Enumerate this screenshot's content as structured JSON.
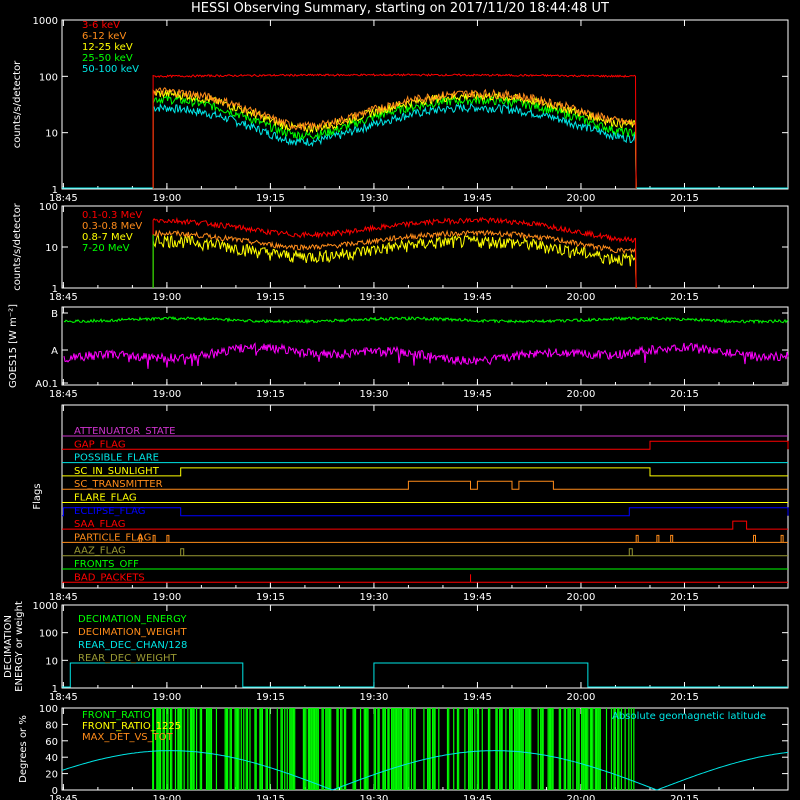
{
  "title": "HESSI Observing Summary, starting on 2017/11/20 18:44:48 UT",
  "time_ticks": [
    "18:45",
    "19:00",
    "19:15",
    "19:30",
    "19:45",
    "20:00",
    "20:15"
  ],
  "colors": {
    "red": "#ff0000",
    "orange": "#ff8c1a",
    "yellow": "#ffff00",
    "green": "#00ff00",
    "cyan": "#00e6e6",
    "magenta": "#ff00ff",
    "blue": "#0000ff",
    "white": "#ffffff",
    "olive": "#999933",
    "purple": "#cc33cc"
  },
  "chart_data": [
    {
      "id": "lo_energy",
      "type": "line",
      "ylabel": "counts/s/detector",
      "yscale": "log",
      "ylim": [
        1,
        1000
      ],
      "yticks": [
        "1",
        "10",
        "100",
        "1000"
      ],
      "x_start": "18:58",
      "x_end": "20:08",
      "series": [
        {
          "name": "3-6 keV",
          "color": "red",
          "values_at": {
            "start": 100,
            "mid": 110,
            "end": 90
          }
        },
        {
          "name": "6-12 keV",
          "color": "orange",
          "values_at": {
            "start": 55,
            "min": 13,
            "peak": 50,
            "end": 15
          }
        },
        {
          "name": "12-25 keV",
          "color": "yellow",
          "values_at": {
            "start": 50,
            "min": 12,
            "peak": 45,
            "end": 14
          }
        },
        {
          "name": "25-50 keV",
          "color": "green",
          "values_at": {
            "start": 40,
            "min": 9,
            "peak": 38,
            "end": 10
          }
        },
        {
          "name": "50-100 keV",
          "color": "cyan",
          "values_at": {
            "start": 28,
            "min": 7,
            "peak": 28,
            "end": 8
          }
        }
      ]
    },
    {
      "id": "hi_energy",
      "type": "line",
      "ylabel": "counts/s/detector",
      "yscale": "log",
      "ylim": [
        1,
        100
      ],
      "yticks": [
        "1",
        "10",
        "100"
      ],
      "series": [
        {
          "name": "0.1-0.3 MeV",
          "color": "red",
          "values_at": {
            "start": 45,
            "min": 20,
            "peak": 45,
            "end": 15
          }
        },
        {
          "name": "0.3-0.8 MeV",
          "color": "orange",
          "values_at": {
            "start": 22,
            "min": 10,
            "peak": 22,
            "end": 8
          }
        },
        {
          "name": "0.8-7 MeV",
          "color": "yellow",
          "values_at": {
            "start": 15,
            "min": 6,
            "peak": 14,
            "end": 5
          }
        },
        {
          "name": "7-20 MeV",
          "color": "green",
          "values_at": {}
        }
      ]
    },
    {
      "id": "goes",
      "type": "line",
      "ylabel": "GOES15 [W m⁻²]",
      "yticks": [
        "A0.1",
        "A",
        "B"
      ],
      "series": [
        {
          "color": "green",
          "level": "B-"
        },
        {
          "color": "magenta",
          "level": "A"
        }
      ]
    },
    {
      "id": "flags",
      "type": "line",
      "ylabel": "Flags",
      "flags": [
        {
          "name": "ATTENUATOR_STATE",
          "color": "purple"
        },
        {
          "name": "GAP_FLAG",
          "color": "red",
          "on": [
            [
              "20:10",
              "20:30"
            ]
          ]
        },
        {
          "name": "POSSIBLE_FLARE",
          "color": "cyan"
        },
        {
          "name": "SC_IN_SUNLIGHT",
          "color": "yellow",
          "on": [
            [
              "19:02",
              "20:10"
            ]
          ]
        },
        {
          "name": "SC_TRANSMITTER",
          "color": "orange",
          "on": [
            [
              "19:35",
              "19:44"
            ],
            [
              "19:45",
              "19:50"
            ],
            [
              "19:51",
              "19:56"
            ]
          ]
        },
        {
          "name": "FLARE_FLAG",
          "color": "yellow"
        },
        {
          "name": "ECLIPSE_FLAG",
          "color": "blue",
          "on": [
            [
              "18:45",
              "19:02"
            ],
            [
              "20:07",
              "20:30"
            ]
          ]
        },
        {
          "name": "SAA_FLAG",
          "color": "red",
          "on": [
            [
              "20:22",
              "20:24"
            ]
          ]
        },
        {
          "name": "PARTICLE_FLAG",
          "color": "orange"
        },
        {
          "name": "AAZ_FLAG",
          "color": "olive"
        },
        {
          "name": "FRONTS_OFF",
          "color": "green"
        },
        {
          "name": "BAD_PACKETS",
          "color": "red"
        }
      ]
    },
    {
      "id": "decimation",
      "type": "line",
      "ylabel": "DECIMATION ENERGY or weight",
      "yscale": "log",
      "ylim": [
        1,
        1000
      ],
      "yticks": [
        "1",
        "10",
        "100",
        "1000"
      ],
      "series": [
        {
          "name": "DECIMATION_ENERGY",
          "color": "green"
        },
        {
          "name": "DECIMATION_WEIGHT",
          "color": "orange"
        },
        {
          "name": "REAR_DEC_CHAN/128",
          "color": "cyan",
          "on": [
            [
              "18:46",
              "19:11"
            ],
            [
              "19:30",
              "20:01"
            ]
          ],
          "value": 8
        },
        {
          "name": "REAR_DEC_WEIGHT",
          "color": "olive"
        }
      ]
    },
    {
      "id": "ratio",
      "type": "line",
      "ylabel": "Degrees or %",
      "ylim": [
        0,
        100
      ],
      "yticks": [
        "0",
        "20",
        "40",
        "60",
        "80",
        "100"
      ],
      "series": [
        {
          "name": "FRONT_RATIO",
          "color": "green"
        },
        {
          "name": "FRONT_RATIO_1225",
          "color": "yellow"
        },
        {
          "name": "MAX_DET_VS_TOT",
          "color": "orange"
        },
        {
          "name": "Absolute geomagnetic latitude",
          "color": "cyan"
        }
      ]
    }
  ]
}
